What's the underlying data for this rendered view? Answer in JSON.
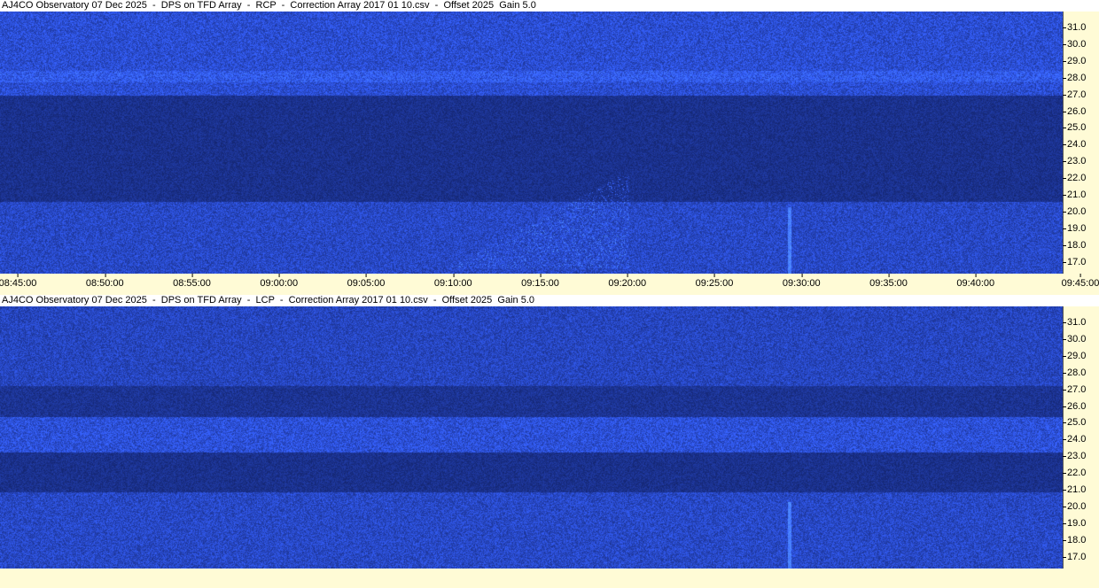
{
  "panels": [
    {
      "id": "rcp",
      "title": "AJ4CO Observatory 07 Dec 2025  -  DPS on TFD Array  -  RCP  -  Correction Array 2017 01 10.csv  -  Offset 2025  Gain 5.0",
      "freq_ticks": [
        "31.0",
        "30.0",
        "29.0",
        "28.0",
        "27.0",
        "26.0",
        "25.0",
        "24.0",
        "23.0",
        "22.0",
        "21.0",
        "20.0",
        "19.0",
        "18.0",
        "17.0"
      ],
      "time_ticks": [
        "08:45:00",
        "08:50:00",
        "08:55:00",
        "09:00:00",
        "09:05:00",
        "09:10:00",
        "09:15:00",
        "09:20:00",
        "09:25:00",
        "09:30:00",
        "09:35:00",
        "09:40:00",
        "09:45:00"
      ]
    },
    {
      "id": "lcp",
      "title": "AJ4CO Observatory 07 Dec 2025  -  DPS on TFD Array  -  LCP  -  Correction Array 2017 01 10.csv  -  Offset 2025  Gain 5.0",
      "freq_ticks": [
        "31.0",
        "30.0",
        "29.0",
        "28.0",
        "27.0",
        "26.0",
        "25.0",
        "24.0",
        "23.0",
        "22.0",
        "21.0",
        "20.0",
        "19.0",
        "18.0",
        "17.0"
      ],
      "time_ticks": []
    }
  ],
  "colors": {
    "background": "#fffbd6",
    "spectrogram_base": "#0a1a7e",
    "burst": "#4aa8ff"
  }
}
